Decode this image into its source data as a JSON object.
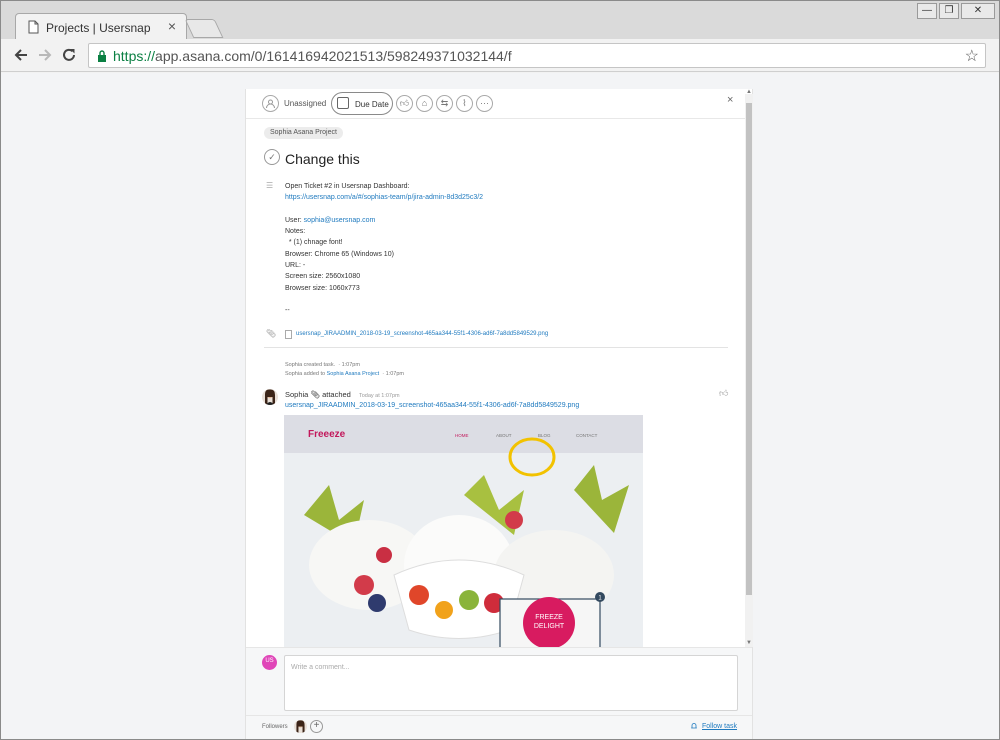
{
  "browser": {
    "tab_title": "Projects | Usersnap",
    "tab_close": "×",
    "url_scheme": "https://",
    "url_rest": "app.asana.com/0/161416942021513/598249371032144/f",
    "window_controls": [
      "—",
      "❐",
      "✕"
    ]
  },
  "task": {
    "assignee_label": "Unassigned",
    "due_date_label": "Due Date",
    "close_symbol": "×",
    "project_tag": "Sophia Asana Project",
    "title": "Change this",
    "description": [
      {
        "text": "Open Ticket #2 in Usersnap Dashboard:",
        "link": false
      },
      {
        "text": "https://usersnap.com/a/#/sophias-team/p/jira-admin-8d3d25c3/2",
        "link": true
      },
      {
        "text": "",
        "link": false
      },
      {
        "prefix": "User: ",
        "text": "sophia@usersnap.com",
        "link": true
      },
      {
        "text": "Notes:",
        "link": false
      },
      {
        "text": "  * (1) chnage font!",
        "link": false
      },
      {
        "text": "Browser: Chrome 65 (Windows 10)",
        "link": false
      },
      {
        "text": "URL: -",
        "link": false
      },
      {
        "text": "Screen size: 2560x1080",
        "link": false
      },
      {
        "text": "Browser size: 1060x773",
        "link": false
      },
      {
        "text": "",
        "link": false
      },
      {
        "text": "--",
        "link": false
      }
    ],
    "attachment_filename": "usersnap_JIRAADMIN_2018-03-19_screenshot-465aa344-55f1-4306-ad6f-7a8dd5849529.png",
    "story_created": {
      "text": "Sophia created task.",
      "time": "1:07pm"
    },
    "story_added": {
      "prefix": "Sophia added to ",
      "link": "Sophia Asana Project",
      "time": "1:07pm"
    },
    "comment": {
      "author": "Sophia",
      "action": "attached",
      "time": "Today at 1:07pm",
      "file_link": "usersnap_JIRAADMIN_2018-03-19_screenshot-465aa344-55f1-4306-ad6f-7a8dd5849529.png"
    },
    "screenshot": {
      "logo": "Freeeze",
      "nav": [
        "HOME",
        "ABOUT",
        "BLOG",
        "CONTACT"
      ],
      "badge_line1": "FREEZE",
      "badge_line2": "DELIGHT",
      "marker": "1"
    },
    "composer": {
      "avatar_initials": "US",
      "placeholder": "Write a comment..."
    },
    "followers_label": "Followers",
    "follow_task_label": "Follow task"
  },
  "colors": {
    "link": "#1f7abf",
    "secure_green": "#0b8043",
    "annotation_yellow": "#f2c200",
    "avatar_pink": "#e046b8"
  }
}
